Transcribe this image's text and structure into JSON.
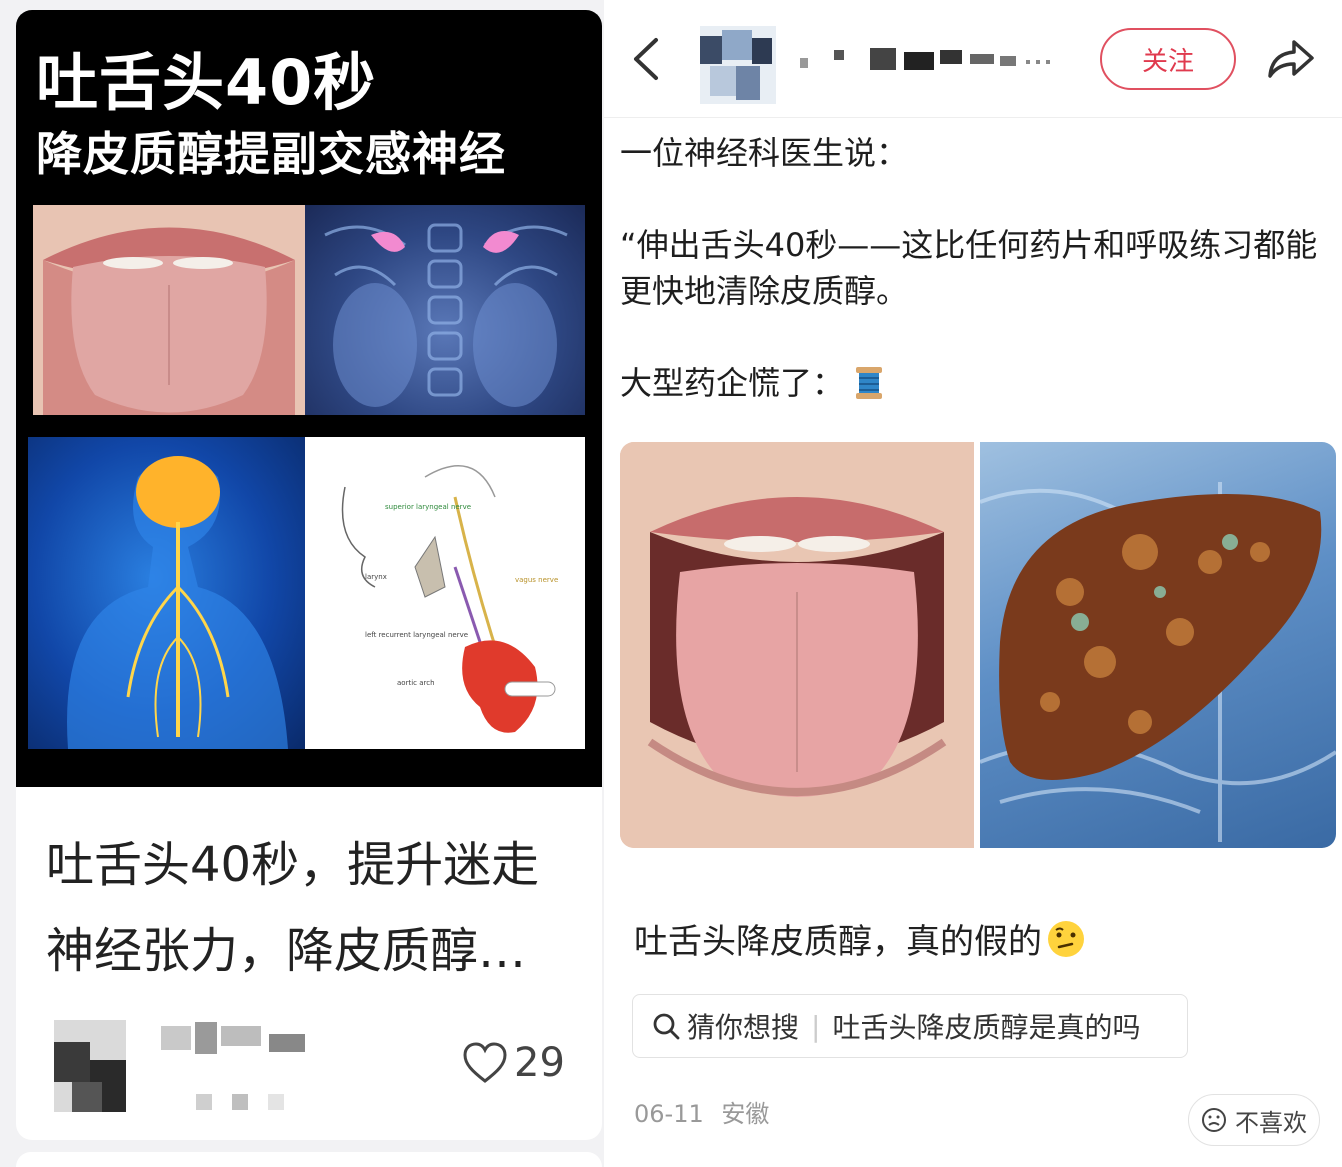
{
  "left_card": {
    "cover_title_line1": "吐舌头40秒",
    "cover_title_line2": "降皮质醇提副交感神经",
    "diagram_labels": {
      "superior_nerve": "superior laryngeal nerve",
      "larynx": "larynx",
      "vagus": "vagus nerve",
      "recurrent": "left recurrent laryngeal nerve",
      "aortic": "aortic arch"
    },
    "caption_line1": "吐舌头40秒，提升迷走",
    "caption_line2": "神经张力，降皮质醇…",
    "like_count": "29",
    "like_icon": "heart-outline-icon"
  },
  "right_post": {
    "follow_label": "关注",
    "accent_color": "#e03a4e",
    "body_line1": "一位神经科医生说：",
    "body_quote": "“伸出舌头40秒——这比任何药片和呼吸练习都能更快地清除皮质醇。",
    "body_line3": "大型药企慌了：",
    "title": "吐舌头降皮质醇，真的假的",
    "search_prefix": "猜你想搜",
    "search_query": "吐舌头降皮质醇是真的吗",
    "date": "06-11",
    "location": "安徽",
    "dislike_label": "不喜欢"
  }
}
